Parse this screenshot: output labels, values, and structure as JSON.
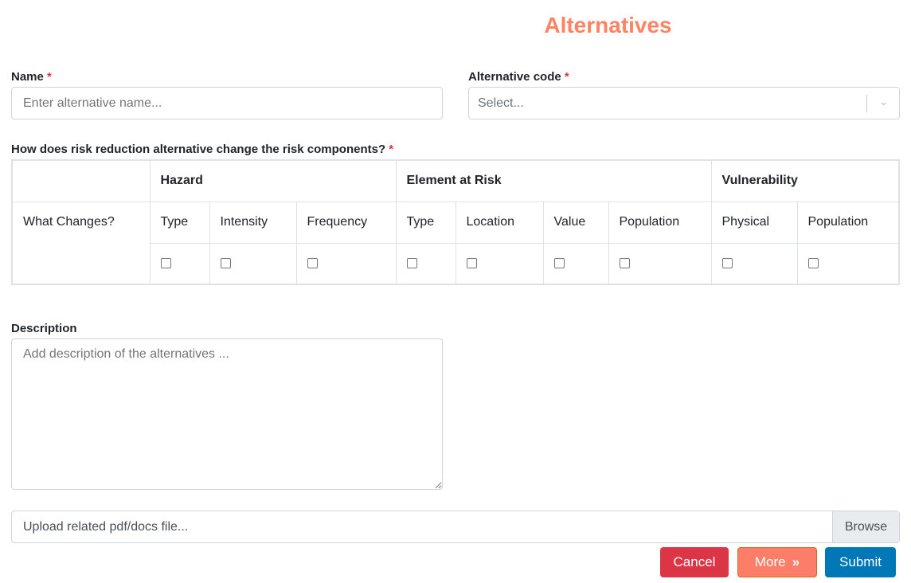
{
  "title": "Alternatives",
  "name": {
    "label": "Name",
    "required": "*",
    "placeholder": "Enter alternative name..."
  },
  "code": {
    "label": "Alternative code",
    "required": "*",
    "placeholder": "Select..."
  },
  "question": {
    "label": "How does risk reduction alternative change the risk components?",
    "required": "*"
  },
  "table": {
    "row_label": "What Changes?",
    "groups": [
      "Hazard",
      "Element at Risk",
      "Vulnerability"
    ],
    "columns": [
      "Type",
      "Intensity",
      "Frequency",
      "Type",
      "Location",
      "Value",
      "Population",
      "Physical",
      "Population"
    ]
  },
  "description": {
    "label": "Description",
    "placeholder": "Add description of the alternatives ..."
  },
  "upload": {
    "placeholder": "Upload related pdf/docs file...",
    "browse": "Browse"
  },
  "buttons": {
    "cancel": "Cancel",
    "more": "More",
    "submit": "Submit"
  },
  "colors": {
    "title": "#fd8362",
    "cancel": "#dc3545",
    "more": "#fd7e68",
    "submit": "#0077b6"
  }
}
